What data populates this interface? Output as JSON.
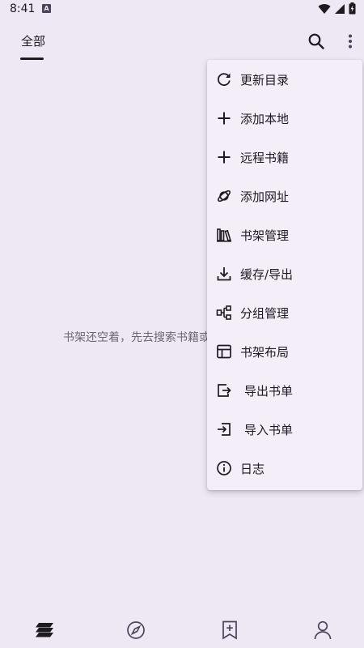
{
  "status_bar": {
    "time": "8:41",
    "notif_letter": "A"
  },
  "tabs": [
    {
      "label": "全部",
      "selected": true
    }
  ],
  "toolbar": {
    "search_icon": "search-icon",
    "more_icon": "more-vert-icon"
  },
  "empty_state": {
    "text": "书架还空着，先去搜索书籍或"
  },
  "menu": {
    "items": [
      {
        "label": "更新目录",
        "icon": "refresh-icon"
      },
      {
        "label": "添加本地",
        "icon": "plus-icon"
      },
      {
        "label": "远程书籍",
        "icon": "plus-icon"
      },
      {
        "label": "添加网址",
        "icon": "planet-icon"
      },
      {
        "label": "书架管理",
        "icon": "books-icon"
      },
      {
        "label": "缓存/导出",
        "icon": "download-icon"
      },
      {
        "label": "分组管理",
        "icon": "group-icon"
      },
      {
        "label": "书架布局",
        "icon": "layout-icon"
      },
      {
        "label": "导出书单",
        "icon": "export-icon"
      },
      {
        "label": "导入书单",
        "icon": "import-icon"
      },
      {
        "label": "日志",
        "icon": "info-icon"
      }
    ]
  },
  "bottom_nav": {
    "items": [
      {
        "name": "bookshelf",
        "icon": "bookshelf-icon",
        "selected": true
      },
      {
        "name": "explore",
        "icon": "compass-icon"
      },
      {
        "name": "rss",
        "icon": "bookmark-plus-icon"
      },
      {
        "name": "my",
        "icon": "person-icon"
      }
    ]
  },
  "colors": {
    "background": "#EEE8F4",
    "menu_bg": "#F3EEF8",
    "text": "#1D1B20",
    "muted": "#6B6676"
  }
}
